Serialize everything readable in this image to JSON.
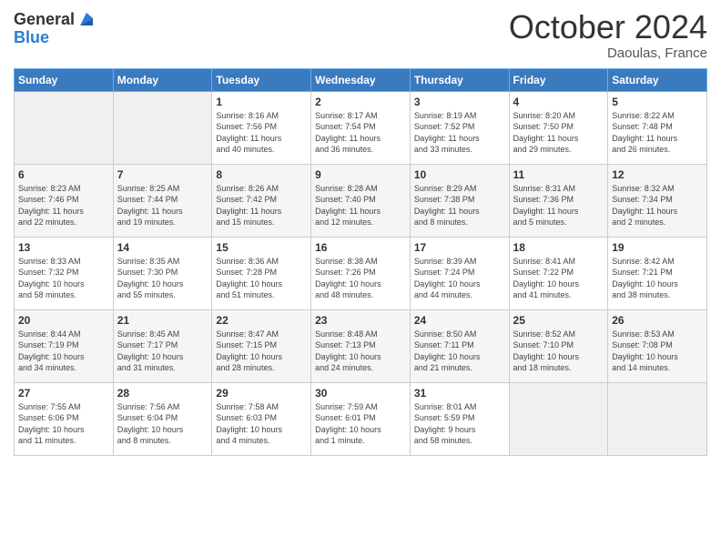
{
  "header": {
    "logo": {
      "general": "General",
      "blue": "Blue"
    },
    "month": "October 2024",
    "location": "Daoulas, France"
  },
  "calendar": {
    "columns": [
      "Sunday",
      "Monday",
      "Tuesday",
      "Wednesday",
      "Thursday",
      "Friday",
      "Saturday"
    ],
    "weeks": [
      [
        {
          "day": "",
          "info": ""
        },
        {
          "day": "",
          "info": ""
        },
        {
          "day": "1",
          "info": "Sunrise: 8:16 AM\nSunset: 7:56 PM\nDaylight: 11 hours\nand 40 minutes."
        },
        {
          "day": "2",
          "info": "Sunrise: 8:17 AM\nSunset: 7:54 PM\nDaylight: 11 hours\nand 36 minutes."
        },
        {
          "day": "3",
          "info": "Sunrise: 8:19 AM\nSunset: 7:52 PM\nDaylight: 11 hours\nand 33 minutes."
        },
        {
          "day": "4",
          "info": "Sunrise: 8:20 AM\nSunset: 7:50 PM\nDaylight: 11 hours\nand 29 minutes."
        },
        {
          "day": "5",
          "info": "Sunrise: 8:22 AM\nSunset: 7:48 PM\nDaylight: 11 hours\nand 26 minutes."
        }
      ],
      [
        {
          "day": "6",
          "info": "Sunrise: 8:23 AM\nSunset: 7:46 PM\nDaylight: 11 hours\nand 22 minutes."
        },
        {
          "day": "7",
          "info": "Sunrise: 8:25 AM\nSunset: 7:44 PM\nDaylight: 11 hours\nand 19 minutes."
        },
        {
          "day": "8",
          "info": "Sunrise: 8:26 AM\nSunset: 7:42 PM\nDaylight: 11 hours\nand 15 minutes."
        },
        {
          "day": "9",
          "info": "Sunrise: 8:28 AM\nSunset: 7:40 PM\nDaylight: 11 hours\nand 12 minutes."
        },
        {
          "day": "10",
          "info": "Sunrise: 8:29 AM\nSunset: 7:38 PM\nDaylight: 11 hours\nand 8 minutes."
        },
        {
          "day": "11",
          "info": "Sunrise: 8:31 AM\nSunset: 7:36 PM\nDaylight: 11 hours\nand 5 minutes."
        },
        {
          "day": "12",
          "info": "Sunrise: 8:32 AM\nSunset: 7:34 PM\nDaylight: 11 hours\nand 2 minutes."
        }
      ],
      [
        {
          "day": "13",
          "info": "Sunrise: 8:33 AM\nSunset: 7:32 PM\nDaylight: 10 hours\nand 58 minutes."
        },
        {
          "day": "14",
          "info": "Sunrise: 8:35 AM\nSunset: 7:30 PM\nDaylight: 10 hours\nand 55 minutes."
        },
        {
          "day": "15",
          "info": "Sunrise: 8:36 AM\nSunset: 7:28 PM\nDaylight: 10 hours\nand 51 minutes."
        },
        {
          "day": "16",
          "info": "Sunrise: 8:38 AM\nSunset: 7:26 PM\nDaylight: 10 hours\nand 48 minutes."
        },
        {
          "day": "17",
          "info": "Sunrise: 8:39 AM\nSunset: 7:24 PM\nDaylight: 10 hours\nand 44 minutes."
        },
        {
          "day": "18",
          "info": "Sunrise: 8:41 AM\nSunset: 7:22 PM\nDaylight: 10 hours\nand 41 minutes."
        },
        {
          "day": "19",
          "info": "Sunrise: 8:42 AM\nSunset: 7:21 PM\nDaylight: 10 hours\nand 38 minutes."
        }
      ],
      [
        {
          "day": "20",
          "info": "Sunrise: 8:44 AM\nSunset: 7:19 PM\nDaylight: 10 hours\nand 34 minutes."
        },
        {
          "day": "21",
          "info": "Sunrise: 8:45 AM\nSunset: 7:17 PM\nDaylight: 10 hours\nand 31 minutes."
        },
        {
          "day": "22",
          "info": "Sunrise: 8:47 AM\nSunset: 7:15 PM\nDaylight: 10 hours\nand 28 minutes."
        },
        {
          "day": "23",
          "info": "Sunrise: 8:48 AM\nSunset: 7:13 PM\nDaylight: 10 hours\nand 24 minutes."
        },
        {
          "day": "24",
          "info": "Sunrise: 8:50 AM\nSunset: 7:11 PM\nDaylight: 10 hours\nand 21 minutes."
        },
        {
          "day": "25",
          "info": "Sunrise: 8:52 AM\nSunset: 7:10 PM\nDaylight: 10 hours\nand 18 minutes."
        },
        {
          "day": "26",
          "info": "Sunrise: 8:53 AM\nSunset: 7:08 PM\nDaylight: 10 hours\nand 14 minutes."
        }
      ],
      [
        {
          "day": "27",
          "info": "Sunrise: 7:55 AM\nSunset: 6:06 PM\nDaylight: 10 hours\nand 11 minutes."
        },
        {
          "day": "28",
          "info": "Sunrise: 7:56 AM\nSunset: 6:04 PM\nDaylight: 10 hours\nand 8 minutes."
        },
        {
          "day": "29",
          "info": "Sunrise: 7:58 AM\nSunset: 6:03 PM\nDaylight: 10 hours\nand 4 minutes."
        },
        {
          "day": "30",
          "info": "Sunrise: 7:59 AM\nSunset: 6:01 PM\nDaylight: 10 hours\nand 1 minute."
        },
        {
          "day": "31",
          "info": "Sunrise: 8:01 AM\nSunset: 5:59 PM\nDaylight: 9 hours\nand 58 minutes."
        },
        {
          "day": "",
          "info": ""
        },
        {
          "day": "",
          "info": ""
        }
      ]
    ]
  }
}
